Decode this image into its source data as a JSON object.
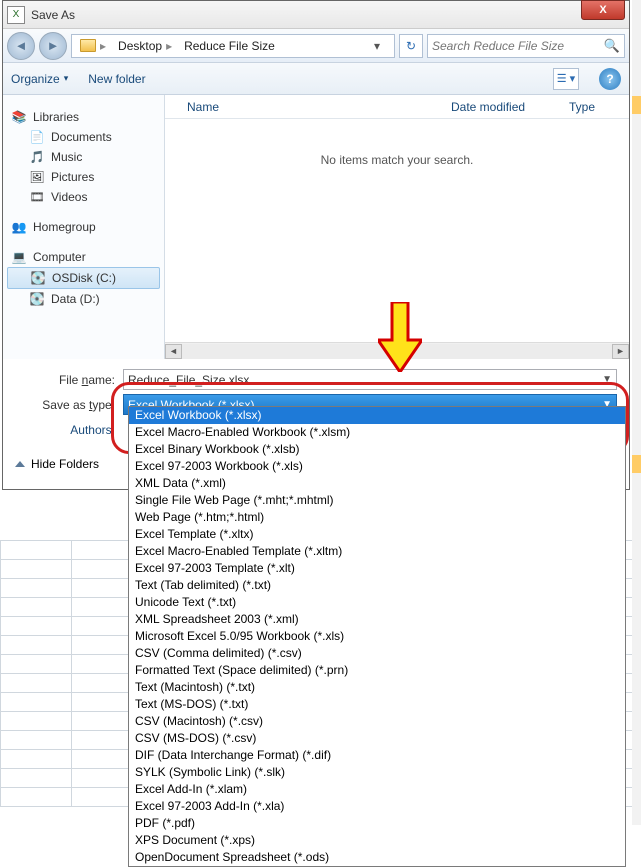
{
  "window": {
    "title": "Save As",
    "close_label": "X"
  },
  "breadcrumb": {
    "loc1": "Desktop",
    "loc2": "Reduce File Size",
    "search_placeholder": "Search Reduce File Size"
  },
  "toolbar": {
    "organize": "Organize",
    "newfolder": "New folder"
  },
  "columns": {
    "name": "Name",
    "date": "Date modified",
    "type": "Type"
  },
  "list": {
    "empty": "No items match your search."
  },
  "nav": {
    "libraries": "Libraries",
    "documents": "Documents",
    "music": "Music",
    "pictures": "Pictures",
    "videos": "Videos",
    "homegroup": "Homegroup",
    "computer": "Computer",
    "osdisk": "OSDisk (C:)",
    "datad": "Data (D:)"
  },
  "form": {
    "filename_label": "File name:",
    "filename_value": "Reduce_File_Size.xlsx",
    "savetype_label": "Save as type:",
    "savetype_value": "Excel Workbook (*.xlsx)",
    "authors_label": "Authors:",
    "hide_folders": "Hide Folders"
  },
  "types": [
    "Excel Workbook (*.xlsx)",
    "Excel Macro-Enabled Workbook (*.xlsm)",
    "Excel Binary Workbook (*.xlsb)",
    "Excel 97-2003 Workbook (*.xls)",
    "XML Data (*.xml)",
    "Single File Web Page (*.mht;*.mhtml)",
    "Web Page (*.htm;*.html)",
    "Excel Template (*.xltx)",
    "Excel Macro-Enabled Template (*.xltm)",
    "Excel 97-2003 Template (*.xlt)",
    "Text (Tab delimited) (*.txt)",
    "Unicode Text (*.txt)",
    "XML Spreadsheet 2003 (*.xml)",
    "Microsoft Excel 5.0/95 Workbook (*.xls)",
    "CSV (Comma delimited) (*.csv)",
    "Formatted Text (Space delimited) (*.prn)",
    "Text (Macintosh) (*.txt)",
    "Text (MS-DOS) (*.txt)",
    "CSV (Macintosh) (*.csv)",
    "CSV (MS-DOS) (*.csv)",
    "DIF (Data Interchange Format) (*.dif)",
    "SYLK (Symbolic Link) (*.slk)",
    "Excel Add-In (*.xlam)",
    "Excel 97-2003 Add-In (*.xla)",
    "PDF (*.pdf)",
    "XPS Document (*.xps)",
    "OpenDocument Spreadsheet (*.ods)"
  ]
}
